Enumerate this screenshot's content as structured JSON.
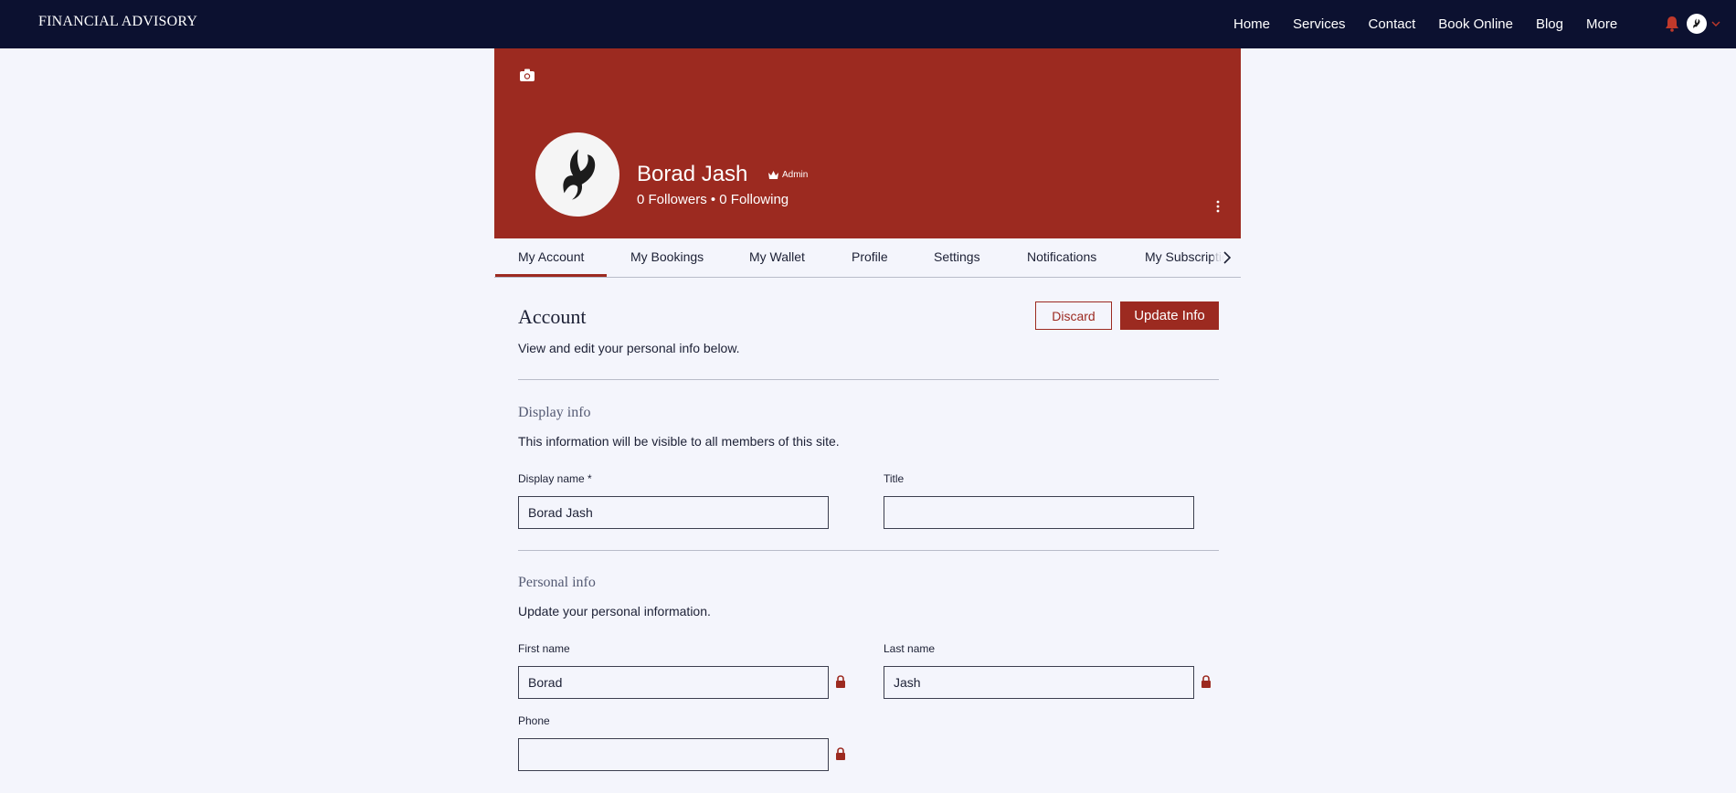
{
  "header": {
    "brand": "FINANCIAL ADVISORY",
    "nav": [
      "Home",
      "Services",
      "Contact",
      "Book Online",
      "Blog",
      "More"
    ],
    "icons": [
      "bell-icon",
      "avatar",
      "chevron-down-icon"
    ]
  },
  "profile": {
    "name": "Borad Jash",
    "badge": "Admin",
    "followers_line": "0 Followers • 0 Following"
  },
  "tabs": [
    "My Account",
    "My Bookings",
    "My Wallet",
    "Profile",
    "Settings",
    "Notifications",
    "My Subscriptions"
  ],
  "account": {
    "title": "Account",
    "subtitle": "View and edit your personal info below.",
    "discard_label": "Discard",
    "update_label": "Update Info"
  },
  "display_info": {
    "title": "Display info",
    "subtitle": "This information will be visible to all members of this site.",
    "display_name_label": "Display name *",
    "display_name_value": "Borad Jash",
    "title_label": "Title",
    "title_value": ""
  },
  "personal_info": {
    "title": "Personal info",
    "subtitle": "Update your personal information.",
    "first_name_label": "First name",
    "first_name_value": "Borad",
    "last_name_label": "Last name",
    "last_name_value": "Jash",
    "phone_label": "Phone",
    "phone_value": ""
  },
  "colors": {
    "nav_bg": "#0c1130",
    "accent": "#9c2a20",
    "page_bg": "#f4f5fc"
  }
}
